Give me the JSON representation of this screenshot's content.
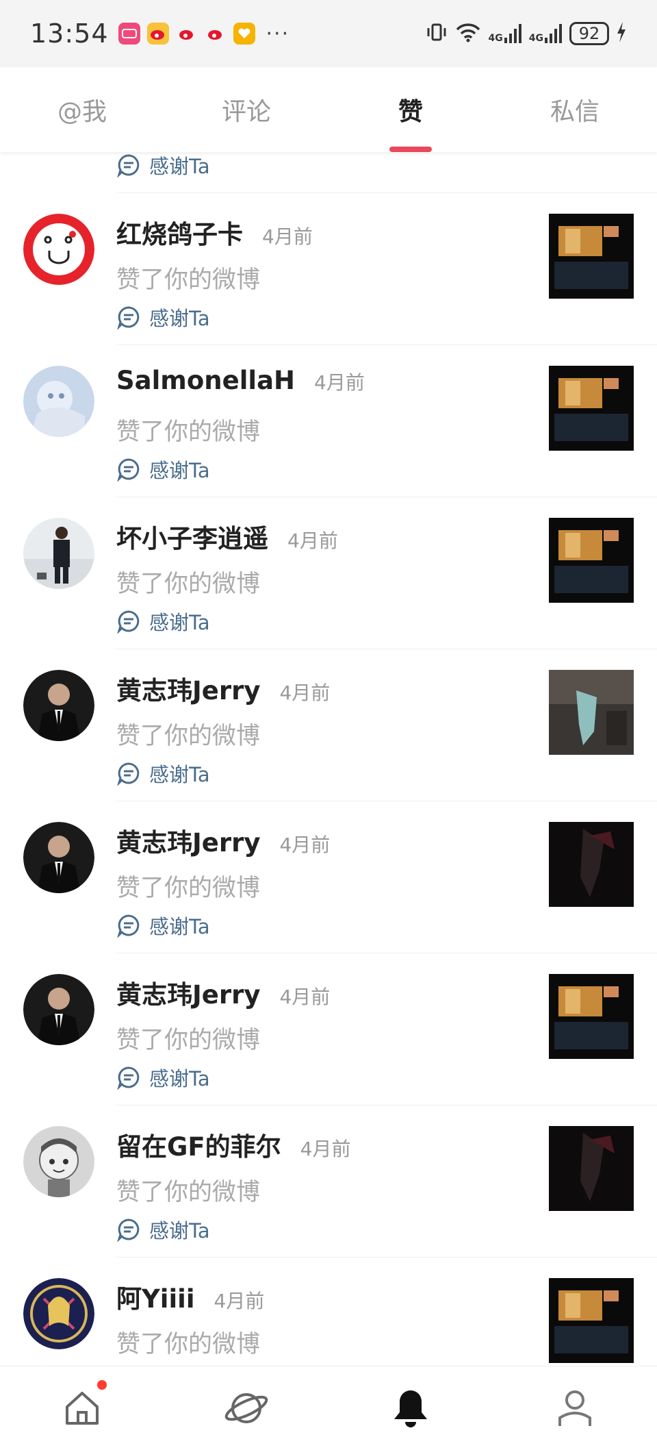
{
  "status_bar": {
    "time": "13:54",
    "notification_icons": [
      "app-icon",
      "weibo-icon",
      "weibo-icon",
      "weibo-icon",
      "heart-shield-icon"
    ],
    "more": "···",
    "network_label_1": "4G",
    "network_label_2": "4G",
    "battery_level": "92"
  },
  "tabs": [
    {
      "label": "@我",
      "active": false
    },
    {
      "label": "评论",
      "active": false
    },
    {
      "label": "赞",
      "active": true
    },
    {
      "label": "私信",
      "active": false
    }
  ],
  "thanks_label": "感谢Ta",
  "items": [
    {
      "name": "红烧鸽子卡",
      "time": "4月前",
      "action": "赞了你的微博",
      "thanks": "感谢Ta",
      "avatar": "avatar-face-icon"
    },
    {
      "name": "SalmonellaH",
      "time": "4月前",
      "action": "赞了你的微博",
      "thanks": "感谢Ta",
      "avatar": "avatar-anime-photo"
    },
    {
      "name": "坏小子李逍遥",
      "time": "4月前",
      "action": "赞了你的微博",
      "thanks": "感谢Ta",
      "avatar": "avatar-person-photo"
    },
    {
      "name": "黄志玮Jerry",
      "time": "4月前",
      "action": "赞了你的微博",
      "thanks": "感谢Ta",
      "avatar": "avatar-suit-photo"
    },
    {
      "name": "黄志玮Jerry",
      "time": "4月前",
      "action": "赞了你的微博",
      "thanks": "感谢Ta",
      "avatar": "avatar-suit-photo"
    },
    {
      "name": "黄志玮Jerry",
      "time": "4月前",
      "action": "赞了你的微博",
      "thanks": "感谢Ta",
      "avatar": "avatar-suit-photo"
    },
    {
      "name": "留在GF的菲尔",
      "time": "4月前",
      "action": "赞了你的微博",
      "thanks": "感谢Ta",
      "avatar": "avatar-cartoon-photo"
    },
    {
      "name": "阿Yiiii",
      "time": "4月前",
      "action": "赞了你的微博",
      "thanks": "",
      "avatar": "avatar-anime-photo"
    }
  ],
  "bottom_nav": [
    {
      "icon": "home-icon",
      "badge": true
    },
    {
      "icon": "planet-icon",
      "badge": false
    },
    {
      "icon": "bell-icon",
      "badge": false
    },
    {
      "icon": "profile-icon",
      "badge": false
    }
  ],
  "colors": {
    "accent": "#e9485b",
    "thanks": "#4a6d8c",
    "muted": "#999999"
  }
}
